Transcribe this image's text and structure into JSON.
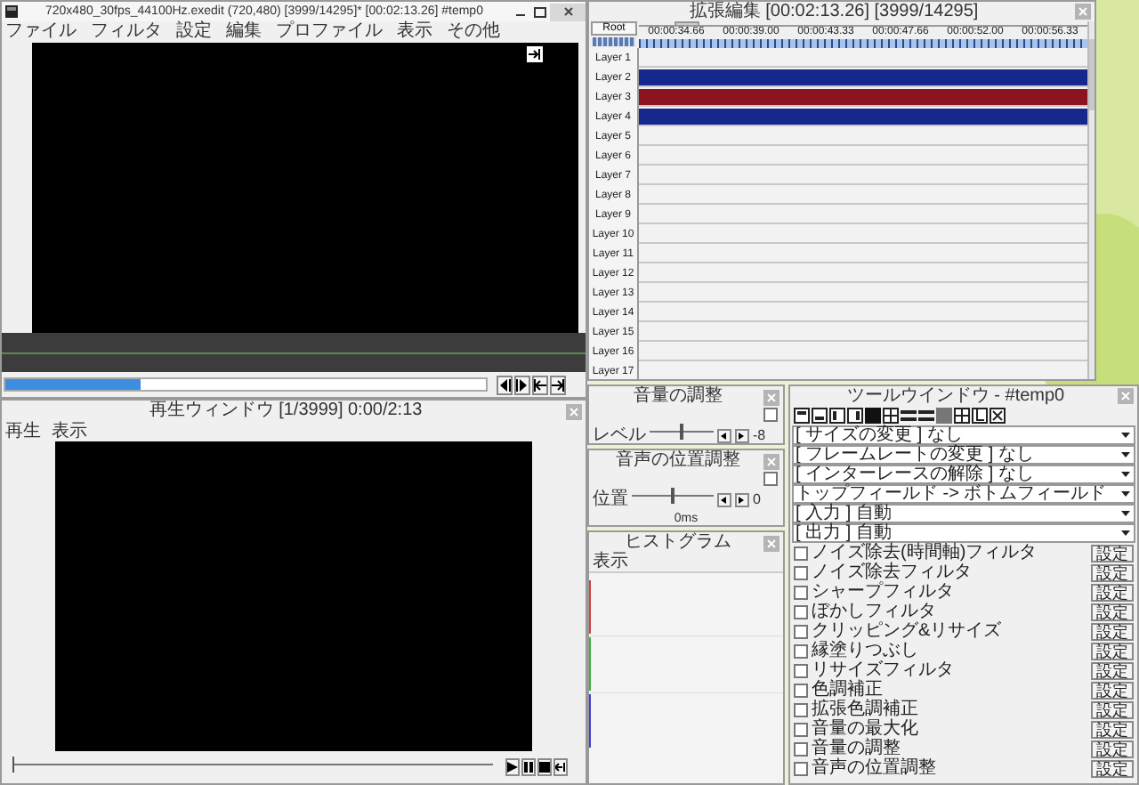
{
  "main_window": {
    "title": "720x480_30fps_44100Hz.exedit (720,480) [3999/14295]* [00:02:13.26] #temp0",
    "menu": [
      "ファイル",
      "フィルタ",
      "設定",
      "編集",
      "プロファイル",
      "表示",
      "その他"
    ],
    "seek_bar": {
      "level": 0.28
    }
  },
  "playback_window": {
    "title": "再生ウィンドウ [1/3999] 0:00/2:13",
    "menu": [
      "再生",
      "表示"
    ],
    "seek_bar": {
      "level": 0
    }
  },
  "timeline_window": {
    "title": "拡張編集 [00:02:13.26] [3999/14295]",
    "root_button": "Root",
    "ruler_times": [
      "00:00:34.66",
      "00:00:39.00",
      "00:00:43.33",
      "00:00:47.66",
      "00:00:52.00",
      "00:00:56.33"
    ],
    "layers": [
      {
        "label": "Layer 1"
      },
      {
        "label": "Layer 2",
        "color": "#16288c"
      },
      {
        "label": "Layer 3",
        "color": "#8c1420"
      },
      {
        "label": "Layer 4",
        "color": "#16288c"
      },
      {
        "label": "Layer 5"
      },
      {
        "label": "Layer 6"
      },
      {
        "label": "Layer 7"
      },
      {
        "label": "Layer 8"
      },
      {
        "label": "Layer 9"
      },
      {
        "label": "Layer 10"
      },
      {
        "label": "Layer 11"
      },
      {
        "label": "Layer 12"
      },
      {
        "label": "Layer 13"
      },
      {
        "label": "Layer 14"
      },
      {
        "label": "Layer 15"
      },
      {
        "label": "Layer 16"
      },
      {
        "label": "Layer 17"
      }
    ]
  },
  "volume_window": {
    "title": "音量の調整",
    "label": "レベル",
    "level": 0.5,
    "value": "-8",
    "checked": false
  },
  "audio_position_window": {
    "title": "音声の位置調整",
    "label": "位置",
    "level": 0.5,
    "value": "0",
    "offset": "0ms",
    "checked": false
  },
  "histogram_window": {
    "title": "ヒストグラム",
    "menu": [
      "表示"
    ]
  },
  "tool_window": {
    "title": "ツールウインドウ - #temp0",
    "dropdowns": [
      "[ サイズの変更 ] なし",
      "[ フレームレートの変更 ] なし",
      "[ インターレースの解除 ] なし",
      "トップフィールド -> ボトムフィールド",
      "[ 入力 ] 自動",
      "[ 出力 ] 自動"
    ],
    "filters": [
      {
        "label": "ノイズ除去(時間軸)フィルタ",
        "checked": false,
        "button": "設定"
      },
      {
        "label": "ノイズ除去フィルタ",
        "checked": false,
        "button": "設定"
      },
      {
        "label": "シャープフィルタ",
        "checked": false,
        "button": "設定"
      },
      {
        "label": "ぼかしフィルタ",
        "checked": false,
        "button": "設定"
      },
      {
        "label": "クリッピング&リサイズ",
        "checked": false,
        "button": "設定"
      },
      {
        "label": "縁塗りつぶし",
        "checked": false,
        "button": "設定"
      },
      {
        "label": "リサイズフィルタ",
        "checked": false,
        "button": "設定"
      },
      {
        "label": "色調補正",
        "checked": false,
        "button": "設定"
      },
      {
        "label": "拡張色調補正",
        "checked": false,
        "button": "設定"
      },
      {
        "label": "音量の最大化",
        "checked": false,
        "button": "設定"
      },
      {
        "label": "音量の調整",
        "checked": false,
        "button": "設定"
      },
      {
        "label": "音声の位置調整",
        "checked": false,
        "button": "設定"
      }
    ]
  }
}
